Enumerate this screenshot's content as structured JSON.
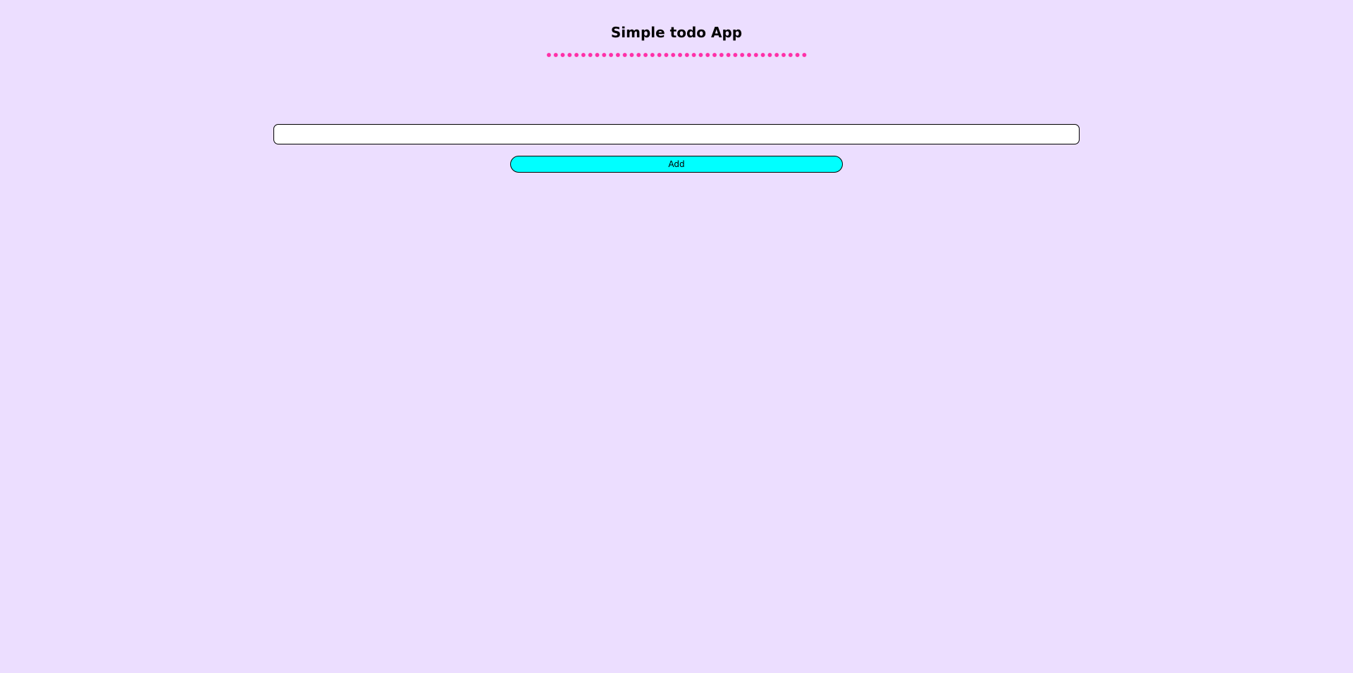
{
  "app": {
    "title": "Simple todo App"
  },
  "todo": {
    "input_value": "",
    "input_placeholder": "",
    "add_label": "Add"
  },
  "colors": {
    "background": "#ecdeff",
    "divider_dots": "#ff2fa8",
    "add_button": "#00ffff"
  }
}
